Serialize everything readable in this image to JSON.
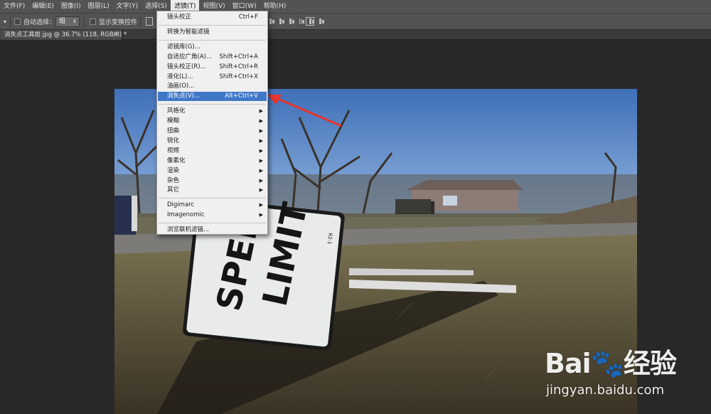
{
  "menubar": {
    "items": [
      "文件(F)",
      "编辑(E)",
      "图像(I)",
      "图层(L)",
      "文字(Y)",
      "选择(S)",
      "滤镜(T)",
      "视图(V)",
      "窗口(W)",
      "帮助(H)"
    ],
    "active_index": 6
  },
  "options": {
    "auto_select_label": "自动选择：",
    "auto_select_value": "组",
    "show_transform_label": "显示变换控件"
  },
  "tab": {
    "title": "消失点工具前.jpg @ 36.7% (118, RGB/8) *",
    "close": "×"
  },
  "filter_menu": {
    "items": [
      {
        "label": "镜头校正",
        "shortcut": "Ctrl+F"
      },
      {
        "sep": true
      },
      {
        "label": "转换为智能滤镜"
      },
      {
        "sep": true
      },
      {
        "label": "滤镜库(G)..."
      },
      {
        "label": "自适应广角(A)...",
        "shortcut": "Shift+Ctrl+A"
      },
      {
        "label": "镜头校正(R)...",
        "shortcut": "Shift+Ctrl+R"
      },
      {
        "label": "液化(L)...",
        "shortcut": "Shift+Ctrl+X"
      },
      {
        "label": "油画(O)..."
      },
      {
        "label": "消失点(V)...",
        "shortcut": "Alt+Ctrl+V",
        "highlighted": true
      },
      {
        "sep": true
      },
      {
        "label": "风格化",
        "submenu": true
      },
      {
        "label": "模糊",
        "submenu": true
      },
      {
        "label": "扭曲",
        "submenu": true
      },
      {
        "label": "锐化",
        "submenu": true
      },
      {
        "label": "视频",
        "submenu": true
      },
      {
        "label": "像素化",
        "submenu": true
      },
      {
        "label": "渲染",
        "submenu": true
      },
      {
        "label": "杂色",
        "submenu": true
      },
      {
        "label": "其它",
        "submenu": true
      },
      {
        "sep": true
      },
      {
        "label": "Digimarc",
        "submenu": true
      },
      {
        "label": "Imagenomic",
        "submenu": true
      },
      {
        "sep": true
      },
      {
        "label": "浏览联机滤镜..."
      }
    ]
  },
  "photo": {
    "sign_line1": "SPEED",
    "sign_line2": "LIMIT",
    "sign_code": "R2-1"
  },
  "watermark": {
    "logo_text": "Bai🐾经验",
    "url": "jingyan.baidu.com"
  },
  "colors": {
    "menu_highlight": "#3f78c7",
    "arrow": "#e8342a",
    "sky": "#4f7fc4"
  }
}
